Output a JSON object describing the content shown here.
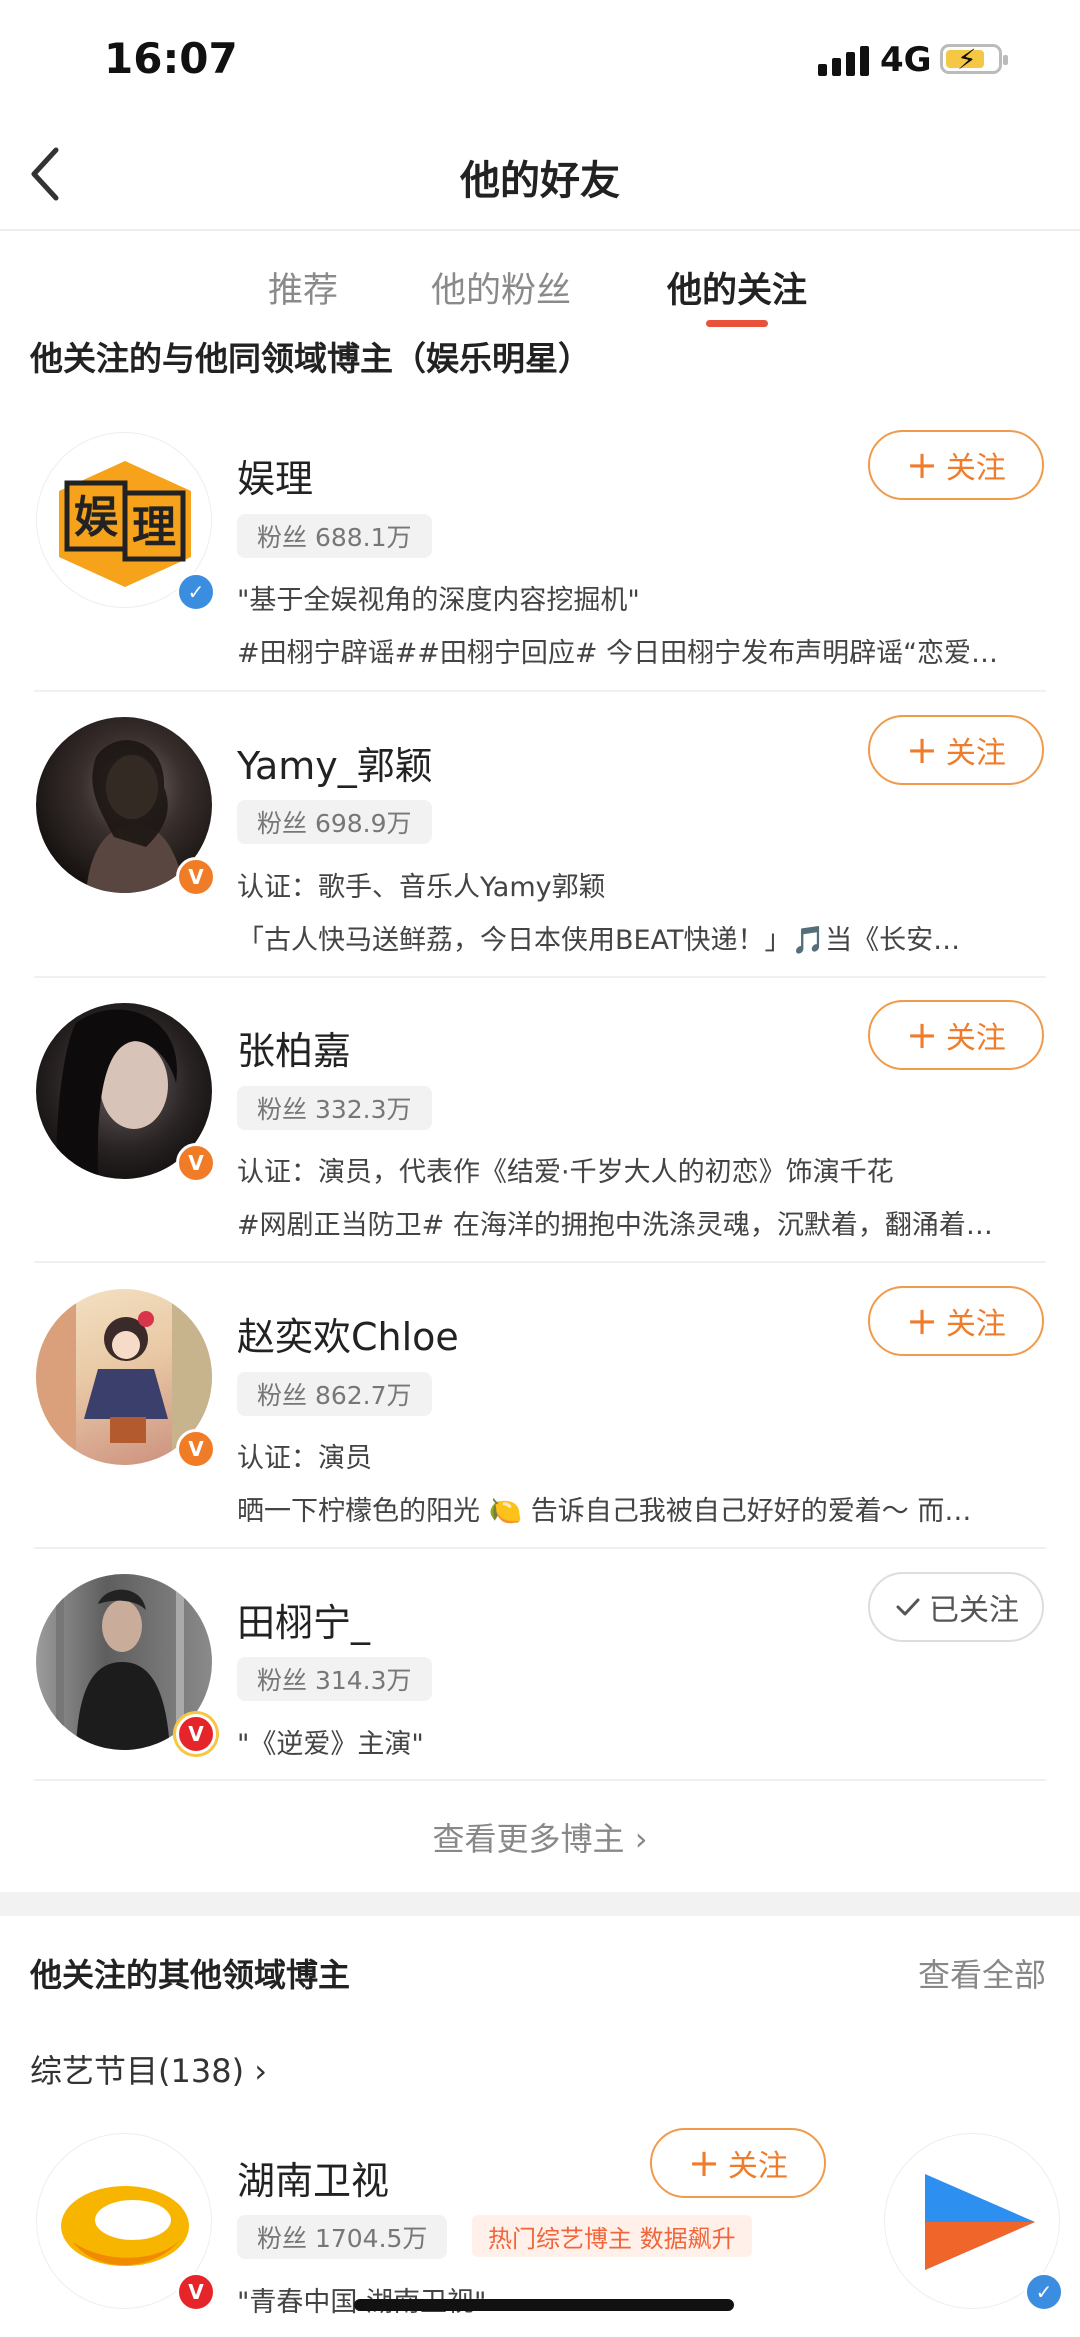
{
  "status_bar": {
    "time": "16:07",
    "network": "4G"
  },
  "header": {
    "title": "他的好友"
  },
  "tabs": [
    {
      "label": "推荐"
    },
    {
      "label": "他的粉丝"
    },
    {
      "label": "他的关注"
    }
  ],
  "section": {
    "title": "他关注的与他同领域博主（娱乐明星）"
  },
  "follow_label": "关注",
  "followed_label": "已关注",
  "users": [
    {
      "name": "娱理",
      "fans": "粉丝 688.1万",
      "line1": "\"基于全娱视角的深度内容挖掘机\"",
      "line2": "#田栩宁辟谣##田栩宁回应# 今日田栩宁发布声明辟谣“恋爱…",
      "status": "关注"
    },
    {
      "name": "Yamy_郭颖",
      "fans": "粉丝 698.9万",
      "line1": "认证：歌手、音乐人Yamy郭颖",
      "line2": "「古人快马送鲜荔，今日本侠用BEAT快递！」🎵当《长安…",
      "status": "关注"
    },
    {
      "name": "张柏嘉",
      "fans": "粉丝 332.3万",
      "line1": "认证：演员，代表作《结爱·千岁大人的初恋》饰演千花",
      "line2": "#网剧正当防卫# 在海洋的拥抱中洗涤灵魂，沉默着，翻涌着…",
      "status": "关注"
    },
    {
      "name": "赵奕欢Chloe",
      "fans": "粉丝 862.7万",
      "line1": "认证：演员",
      "line2": "晒一下柠檬色的阳光 🍋 告诉自己我被自己好好的爱着～ 而…",
      "status": "关注"
    },
    {
      "name": "田栩宁_",
      "fans": "粉丝 314.3万",
      "line1": "\"《逆爱》主演\"",
      "line2": "",
      "status": "已关注"
    }
  ],
  "see_more": "查看更多博主",
  "other_section": {
    "title": "他关注的其他领域博主",
    "view_all": "查看全部",
    "category": "综艺节目(138)",
    "card": {
      "name": "湖南卫视",
      "fans": "粉丝 1704.5万",
      "tag": "热门综艺博主 数据飙升",
      "desc": "\"青春中国 湖南卫视\""
    }
  },
  "colors": {
    "accent": "#ef7c2b",
    "tab_indicator": "#e8513a",
    "verified_blue": "#3b8de0",
    "verified_orange": "#f07c27",
    "verified_red": "#e6252a"
  }
}
